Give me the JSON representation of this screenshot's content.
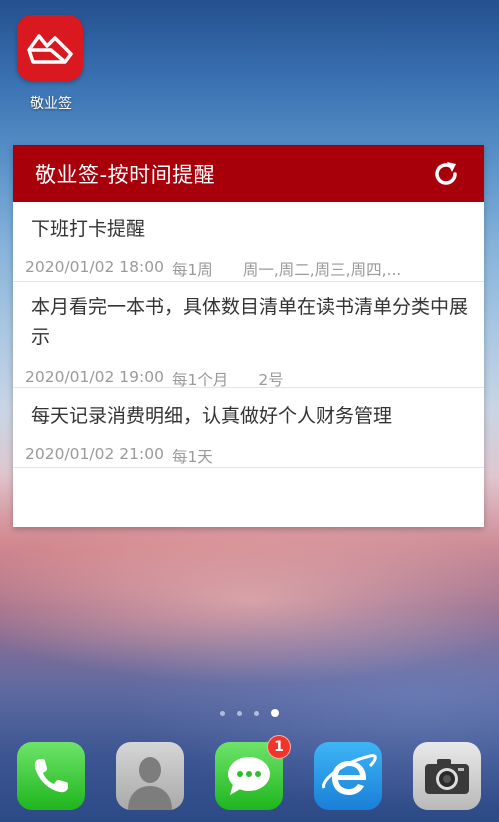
{
  "home": {
    "app_label": "敬业签"
  },
  "widget": {
    "title": "敬业签-按时间提醒",
    "items": [
      {
        "title": "下班打卡提醒",
        "datetime": "2020/01/02 18:00",
        "repeat": "每1周",
        "days": "周一,周二,周三,周四,..."
      },
      {
        "title": "本月看完一本书，具体数目清单在读书清单分类中展示",
        "datetime": "2020/01/02 19:00",
        "repeat": "每1个月",
        "days": "2号"
      },
      {
        "title": "每天记录消费明细，认真做好个人财务管理",
        "datetime": "2020/01/02 21:00",
        "repeat": "每1天",
        "days": ""
      }
    ]
  },
  "pager": {
    "pages": 4,
    "active_index": 3
  },
  "dock": {
    "apps": [
      {
        "icon": "phone-icon"
      },
      {
        "icon": "contacts-icon"
      },
      {
        "icon": "messages-icon",
        "badge": "1"
      },
      {
        "icon": "browser-icon"
      },
      {
        "icon": "camera-icon"
      }
    ]
  },
  "colors": {
    "widget_header": "#a8000a",
    "app_icon_bg": "#d9181f",
    "badge": "#f2352b"
  }
}
